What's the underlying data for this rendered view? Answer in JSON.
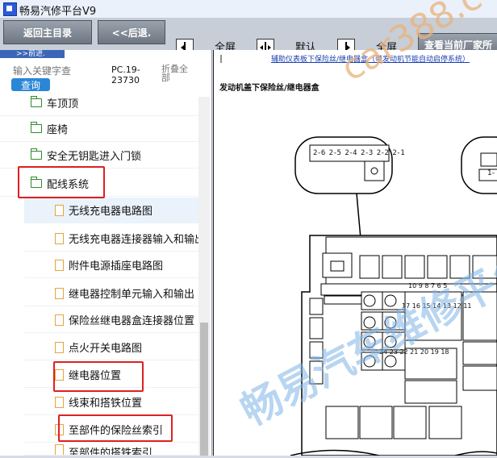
{
  "window": {
    "title": "畅易汽修平台V9"
  },
  "toolbar": {
    "home_label": "返回主目录",
    "back_label": "<<后退.",
    "fullscreen1_label": "全屏",
    "default_label": "默认",
    "fullscreen2_label": "全屏",
    "factory_label": "查看当前厂家所"
  },
  "nav": {
    "tab_label": ">>前进."
  },
  "search": {
    "placeholder": "输入关键字查",
    "button_label": "查询",
    "pc_code": "PC.19-23730",
    "collapse_label": "折叠全部"
  },
  "tree": {
    "items": [
      {
        "label": "车顶顶",
        "type": "folder"
      },
      {
        "label": "座椅",
        "type": "folder"
      },
      {
        "label": "安全无钥匙进入门锁",
        "type": "folder"
      },
      {
        "label": "配线系统",
        "type": "folder"
      },
      {
        "label": "无线充电器电路图",
        "type": "file"
      },
      {
        "label": "无线充电器连接器输入和输出",
        "type": "file"
      },
      {
        "label": "附件电源插座电路图",
        "type": "file"
      },
      {
        "label": "继电器控制单元输入和输出",
        "type": "file"
      },
      {
        "label": "保险丝继电器盒连接器位置",
        "type": "file"
      },
      {
        "label": "点火开关电路图",
        "type": "file"
      },
      {
        "label": "继电器位置",
        "type": "file"
      },
      {
        "label": "线束和搭铁位置",
        "type": "file"
      },
      {
        "label": "至部件的保险丝索引",
        "type": "file"
      },
      {
        "label": "至部件的搭铁索引",
        "type": "file"
      }
    ]
  },
  "diagram": {
    "link_text": "辅助仪表板下保险丝/继电器盒（带发动机节能自动启停系统）",
    "title": "发动机盖下保险丝/继电器盒",
    "connector_pins": "2-6 2-5 2-4 2-3 2-2 2-1",
    "connector_right": "1-",
    "row1": "10 9 8 7 6 5",
    "row2": "17 16 15 14 13 12 11",
    "row3": "24 23 22 21 20 19 18"
  },
  "watermarks": {
    "url": "car388.c",
    "site": "畅易汽车维修平台"
  }
}
